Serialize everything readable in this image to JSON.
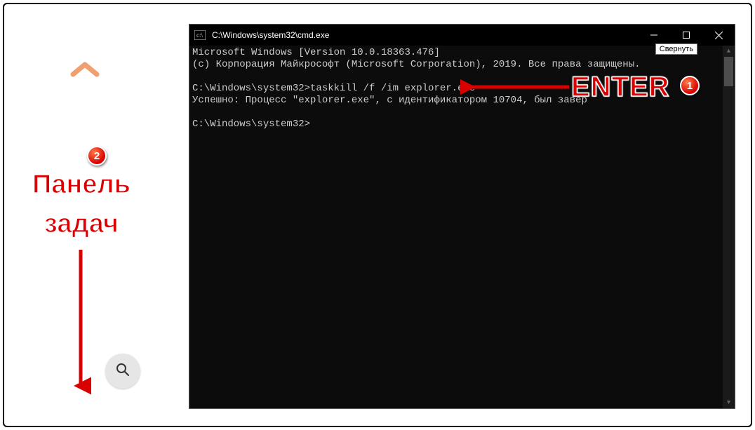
{
  "window": {
    "title": "C:\\Windows\\system32\\cmd.exe",
    "minimize_tooltip": "Свернуть"
  },
  "terminal": {
    "line1": "Microsoft Windows [Version 10.0.18363.476]",
    "line2": "(c) Корпорация Майкрософт (Microsoft Corporation), 2019. Все права защищены.",
    "blank1": "",
    "prompt1_path": "C:\\Windows\\system32>",
    "prompt1_cmd": "taskkill /f /im explorer.exe",
    "result": "Успешно: Процесс \"explorer.exe\", с идентификатором 10704, был завер",
    "blank2": "",
    "prompt2": "C:\\Windows\\system32>"
  },
  "annotations": {
    "enter_label": "ENTER",
    "badge1": "1",
    "panel_label_line1": "Панель",
    "panel_label_line2": "задач",
    "badge2": "2"
  }
}
